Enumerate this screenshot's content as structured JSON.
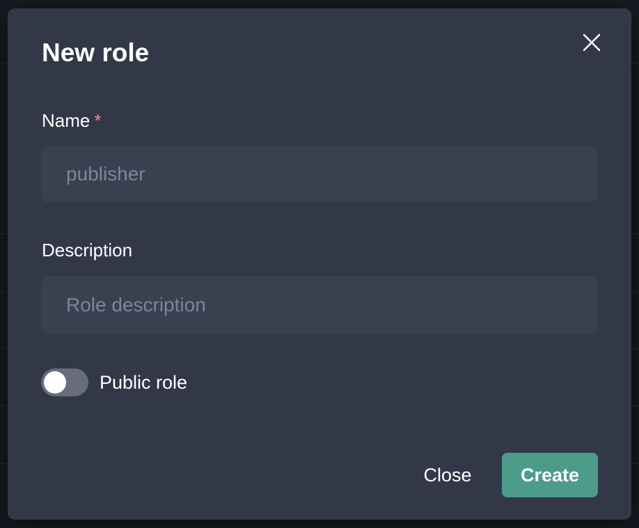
{
  "dialog": {
    "title": "New role",
    "close_icon": "close-icon"
  },
  "form": {
    "name": {
      "label": "Name",
      "required_marker": "*",
      "value": "",
      "placeholder": "publisher"
    },
    "description": {
      "label": "Description",
      "value": "",
      "placeholder": "Role description"
    },
    "public_role": {
      "label": "Public role",
      "checked": false
    }
  },
  "footer": {
    "close_label": "Close",
    "create_label": "Create"
  },
  "colors": {
    "dialog_bg": "#323848",
    "input_bg": "#3a4050",
    "accent": "#4c9b8b",
    "required": "#f08c7f",
    "toggle_off": "#676d7b"
  }
}
